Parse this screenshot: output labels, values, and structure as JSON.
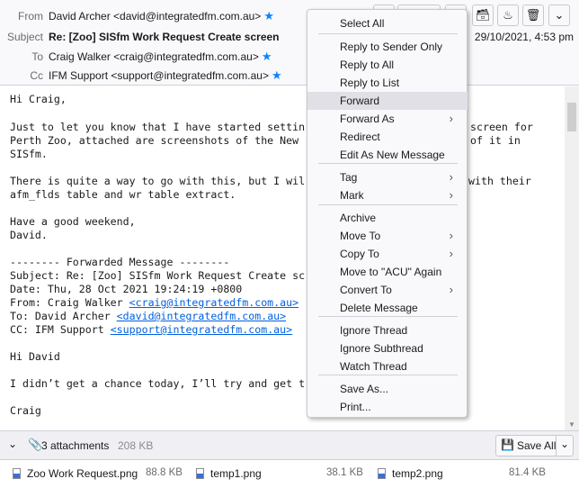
{
  "header": {
    "from_label": "From",
    "from": "David Archer <david@integratedfm.com.au>",
    "subject_label": "Subject",
    "subject": "Re: [Zoo] SISfm Work Request Create screen",
    "to_label": "To",
    "to": "Craig Walker <craig@integratedfm.com.au>",
    "cc_label": "Cc",
    "cc": "IFM Support <support@integratedfm.com.au>",
    "date": "29/10/2021, 4:53 pm"
  },
  "body": {
    "l1": "Hi Craig,",
    "l2": "Just to let you know that I have started settin",
    "l2r": "screen for",
    "l3": "Perth Zoo, attached are screenshots of the New ",
    "l3r": "of it in",
    "l4": "SISfm.",
    "l5": "There is quite a way to go with this, but I wil",
    "l5r": "with their",
    "l6": "afm_flds table and wr table extract.",
    "l7": "Have a good weekend,",
    "l8": "David.",
    "l9": "-------- Forwarded Message --------",
    "l10": "Subject: Re: [Zoo] SISfm Work Request Create sc",
    "l11": "Date: Thu, 28 Oct 2021 19:24:19 +0800",
    "l12a": "From: Craig Walker ",
    "l12b": "<craig@integratedfm.com.au>",
    "l13a": "To: David Archer ",
    "l13b": "<david@integratedfm.com.au>",
    "l14a": "CC: IFM Support ",
    "l14b": "<support@integratedfm.com.au>",
    "l15": "Hi David",
    "l16": "I didn’t get a chance today, I’ll try and get t",
    "l17": "Craig"
  },
  "menu": {
    "items": [
      "Select All",
      "Reply to Sender Only",
      "Reply to All",
      "Reply to List",
      "Forward",
      "Forward As",
      "Redirect",
      "Edit As New Message",
      "Tag",
      "Mark",
      "Archive",
      "Move To",
      "Copy To",
      "Move to \"ACU\" Again",
      "Convert To",
      "Delete Message",
      "Ignore Thread",
      "Ignore Subthread",
      "Watch Thread",
      "Save As...",
      "Print..."
    ]
  },
  "attachments": {
    "count_label": "3 attachments",
    "total_size": "208 KB",
    "save_all": "Save All",
    "files": [
      {
        "name": "Zoo Work Request.png",
        "size": "88.8 KB"
      },
      {
        "name": "temp1.png",
        "size": "38.1 KB"
      },
      {
        "name": "temp2.png",
        "size": "81.4 KB"
      }
    ]
  }
}
